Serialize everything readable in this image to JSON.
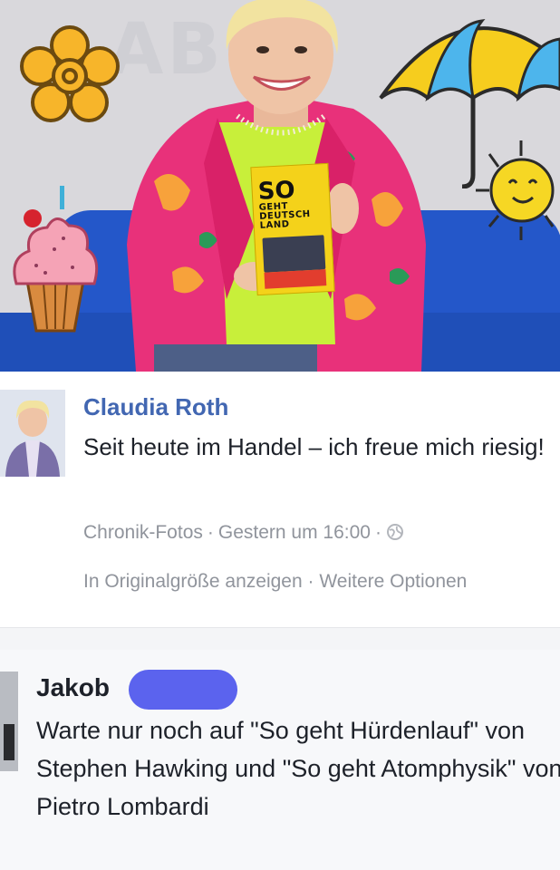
{
  "photo": {
    "wall_letters": "ABC",
    "book": {
      "title_big": "SO",
      "title_line1": "GEHT",
      "title_line2": "DEUTSCH",
      "title_line3": "LAND"
    },
    "colors": {
      "sofa": "#2457c9",
      "jacket": "#e8317a",
      "shirt": "#c8ef3a",
      "book": "#f4d21a"
    }
  },
  "post": {
    "author": "Claudia Roth",
    "text": "Seit heute im Handel – ich freue mich riesig!",
    "meta": {
      "album": "Chronik-Fotos",
      "time": "Gestern um 16:00"
    },
    "actions": {
      "view_full": "In Originalgröße anzeigen",
      "more_options": "Weitere Optionen"
    },
    "link_color": "#4267b2"
  },
  "comment": {
    "author": "Jakob",
    "text": "Warte nur noch auf \"So geht Hürdenlauf\" von Stephen Hawking und \"So geht Atomphysik\" von Pietro Lombardi"
  }
}
